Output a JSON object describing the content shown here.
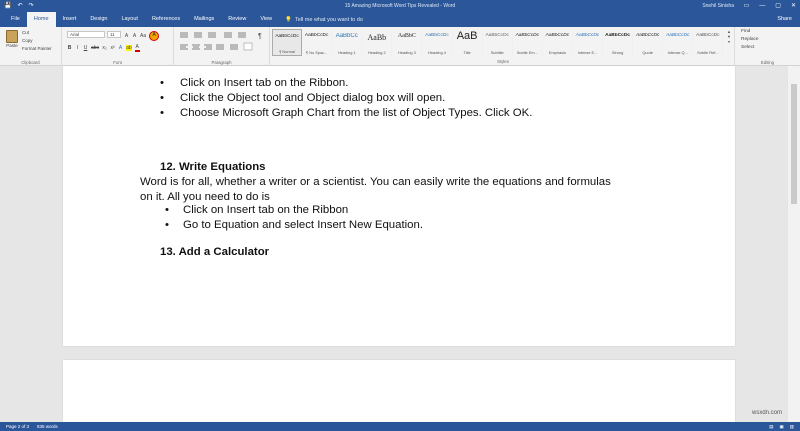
{
  "app": {
    "title": "15 Amazing Microsoft Word Tips Revealed  -  Word",
    "user": "Snehil Sinisha",
    "qat": [
      "💾",
      "↶",
      "↷"
    ],
    "window_buttons": [
      "▭",
      "—",
      "▢",
      "✕"
    ]
  },
  "tabs": [
    "File",
    "Home",
    "Insert",
    "Design",
    "Layout",
    "References",
    "Mailings",
    "Review",
    "View"
  ],
  "tell_me": "Tell me what you want to do",
  "share": "Share",
  "ribbon": {
    "clipboard": {
      "paste": "Paste",
      "items": [
        "Cut",
        "Copy",
        "Format Painter"
      ],
      "label": "Clipboard"
    },
    "font": {
      "name": "Arial",
      "size": "11",
      "row2": [
        "B",
        "I",
        "U",
        "abc",
        "x₂",
        "x²",
        "A",
        "ab",
        "A"
      ],
      "label": "Font"
    },
    "paragraph": {
      "label": "Paragraph"
    },
    "styles": {
      "label": "Styles",
      "items": [
        {
          "preview": "AaBbCcDc",
          "name": "¶ Normal"
        },
        {
          "preview": "AaBbCcDc",
          "name": "¶ No Spac..."
        },
        {
          "preview": "AaBbCc",
          "name": "Heading 1"
        },
        {
          "preview": "AaBb",
          "name": "Heading 2"
        },
        {
          "preview": "AaBbC",
          "name": "Heading 3"
        },
        {
          "preview": "AaBbCcDc",
          "name": "Heading 4"
        },
        {
          "preview": "AaB",
          "name": "Title"
        },
        {
          "preview": "AaBbCcDc",
          "name": "Subtitle"
        },
        {
          "preview": "AaBbCcDc",
          "name": "Subtle Em..."
        },
        {
          "preview": "AaBbCcDc",
          "name": "Emphasis"
        },
        {
          "preview": "AaBbCcDc",
          "name": "Intense E..."
        },
        {
          "preview": "AaBbCcDc",
          "name": "Strong"
        },
        {
          "preview": "AaBbCcDc",
          "name": "Quote"
        },
        {
          "preview": "AaBbCcDc",
          "name": "Intense Q..."
        },
        {
          "preview": "AaBbCcDc",
          "name": "Subtle Ref..."
        }
      ]
    },
    "editing": {
      "items": [
        "Find",
        "Replace",
        "Select"
      ],
      "label": "Editing"
    }
  },
  "document": {
    "bullets_top": [
      "Click on Insert tab on the Ribbon.",
      "Click the Object tool and Object dialog box will open.",
      "Choose Microsoft Graph Chart from the list of Object Types. Click OK."
    ],
    "heading12": "12. Write Equations",
    "para_line1": "Word is for all, whether a writer or a scientist. You can easily write the equations and formulas",
    "para_line2": "on it. All you need to do is",
    "bullets_eq": [
      "Click on Insert tab on the Ribbon",
      "Go to Equation and select Insert New Equation."
    ],
    "heading13": "13. Add a Calculator"
  },
  "status": {
    "page": "Page 2 of 3",
    "words": "836 words"
  },
  "watermark": "wsxdn.com"
}
